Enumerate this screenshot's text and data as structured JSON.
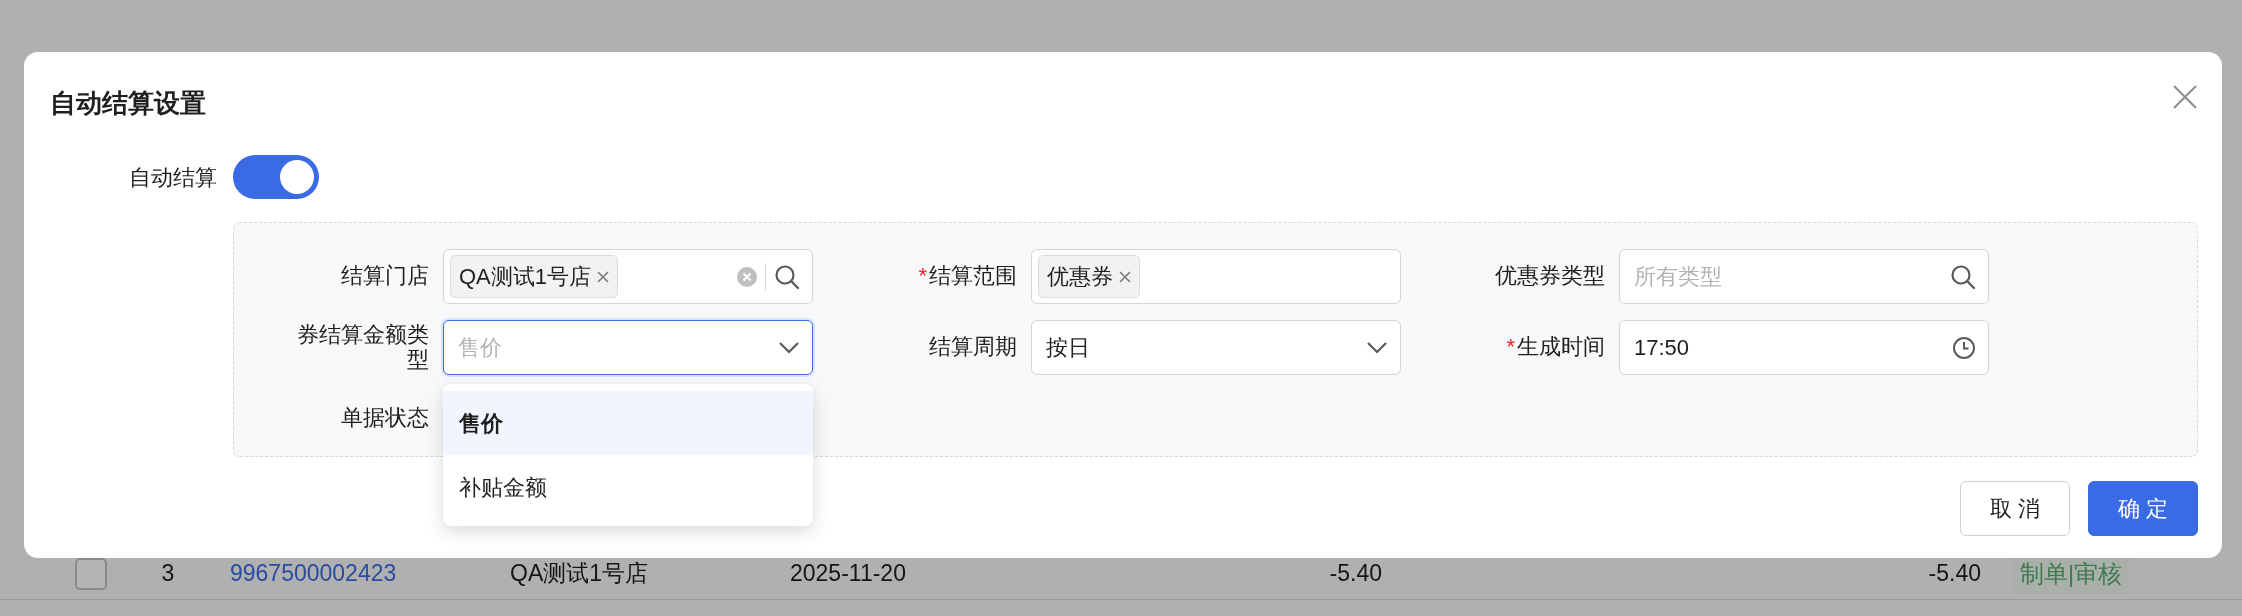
{
  "background_table": {
    "rows": [
      {
        "checked": false,
        "index": "3",
        "doc_no": "9967500002423",
        "store": "QA测试1号店",
        "date": "2025-11-20",
        "amount_1": "-5.40",
        "amount_2": "-5.40",
        "status": "制单|审核"
      }
    ]
  },
  "dialog": {
    "title": "自动结算设置",
    "auto_settle": {
      "label": "自动结算",
      "on": true
    },
    "fields": [
      {
        "label": "结算门店",
        "kind": "tag-search",
        "tags": [
          "QA测试1号店"
        ]
      },
      {
        "label": "结算范围",
        "required_mark": "*",
        "kind": "tags",
        "tags": [
          "优惠券"
        ]
      },
      {
        "label": "优惠券类型",
        "kind": "search",
        "placeholder": "所有类型"
      },
      {
        "label": "券结算金额类型",
        "kind": "select",
        "placeholder": "售价",
        "focused": true,
        "dropdown": {
          "options": [
            {
              "label": "售价",
              "selected": true
            },
            {
              "label": "补贴金额",
              "selected": false
            }
          ]
        }
      },
      {
        "label": "结算周期",
        "kind": "select",
        "value": "按日",
        "focused": false
      },
      {
        "label": "生成时间",
        "required_mark": "*",
        "kind": "time",
        "value": "17:50"
      },
      {
        "label": "单据状态",
        "kind": "none"
      }
    ],
    "buttons": [
      {
        "label": "取 消",
        "kind": "secondary"
      },
      {
        "label": "确 定",
        "kind": "primary"
      }
    ]
  }
}
